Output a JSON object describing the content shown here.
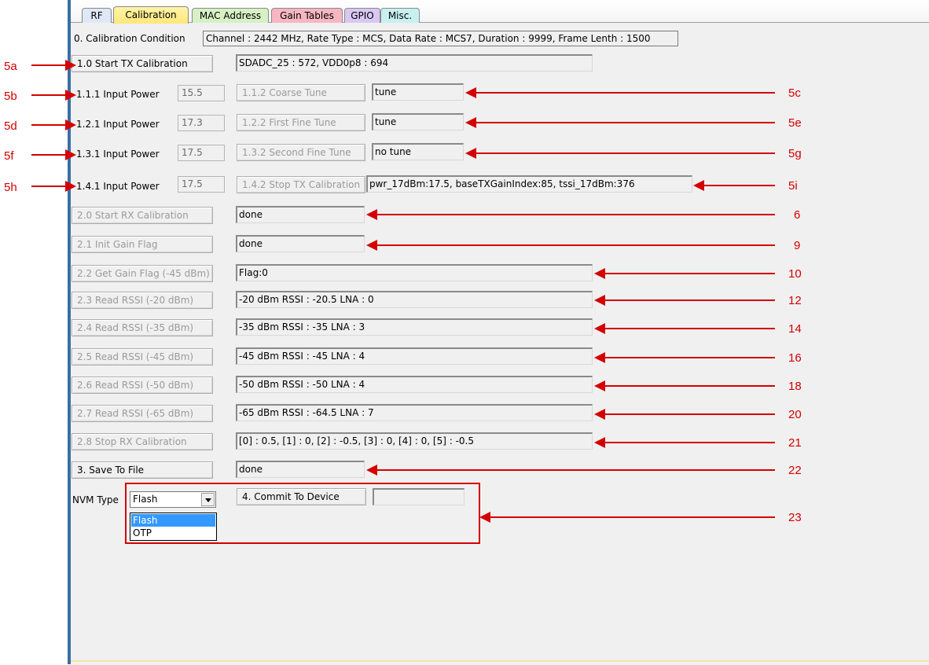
{
  "tabs": [
    {
      "label": "RF",
      "color": "#dfe8f7"
    },
    {
      "label": "Calibration",
      "color": "#ffe77a"
    },
    {
      "label": "MAC Address",
      "color": "#d7f0c4"
    },
    {
      "label": "Gain Tables",
      "color": "#f7b6c2"
    },
    {
      "label": "GPIO",
      "color": "#d9c8f2"
    },
    {
      "label": "Misc.",
      "color": "#c8f0f0"
    }
  ],
  "condition": {
    "label": "0. Calibration Condition",
    "value": "Channel : 2442 MHz, Rate Type : MCS, Data Rate : MCS7, Duration : 9999, Frame Lenth : 1500"
  },
  "tx": {
    "start_button": "1.0 Start TX Calibration",
    "start_result": "SDADC_25 : 572, VDD0p8 : 694",
    "rows": [
      {
        "label": "1.1.1 Input Power",
        "power": "15.5",
        "button": "1.1.2 Coarse Tune",
        "result": "tune"
      },
      {
        "label": "1.2.1 Input Power",
        "power": "17.3",
        "button": "1.2.2 First Fine Tune",
        "result": "tune"
      },
      {
        "label": "1.3.1 Input Power",
        "power": "17.5",
        "button": "1.3.2 Second Fine Tune",
        "result": "no tune"
      },
      {
        "label": "1.4.1 Input Power",
        "power": "17.5",
        "button": "1.4.2 Stop TX Calibration",
        "result": "pwr_17dBm:17.5, baseTXGainIndex:85, tssi_17dBm:376"
      }
    ]
  },
  "rx": {
    "rows": [
      {
        "button": "2.0 Start RX Calibration",
        "result": "done"
      },
      {
        "button": "2.1 Init Gain Flag",
        "result": "done"
      },
      {
        "button": "2.2 Get Gain Flag (-45 dBm)",
        "result": "Flag:0"
      },
      {
        "button": "2.3 Read RSSI (-20 dBm)",
        "result": "-20 dBm RSSI : -20.5 LNA : 0"
      },
      {
        "button": "2.4 Read RSSI (-35 dBm)",
        "result": "-35 dBm RSSI : -35 LNA : 3"
      },
      {
        "button": "2.5 Read RSSI (-45 dBm)",
        "result": "-45 dBm RSSI : -45 LNA : 4"
      },
      {
        "button": "2.6 Read RSSI (-50 dBm)",
        "result": "-50 dBm RSSI : -50 LNA : 4"
      },
      {
        "button": "2.7 Read RSSI (-65 dBm)",
        "result": "-65 dBm RSSI : -64.5 LNA : 7"
      },
      {
        "button": "2.8 Stop RX Calibration",
        "result": "[0] : 0.5, [1] : 0, [2] : -0.5, [3] : 0, [4] : 0, [5] : -0.5"
      }
    ]
  },
  "save": {
    "button": "3. Save To File",
    "result": "done"
  },
  "nvm": {
    "label": "NVM Type",
    "selected": "Flash",
    "options": [
      "Flash",
      "OTP"
    ],
    "commit_button": "4. Commit To Device",
    "commit_result": ""
  },
  "annotations": {
    "left": [
      "5a",
      "5b",
      "5d",
      "5f",
      "5h"
    ],
    "right": [
      "5c",
      "5e",
      "5g",
      "5i",
      "6",
      "9",
      "10",
      "12",
      "14",
      "16",
      "18",
      "20",
      "21",
      "22",
      "23"
    ]
  },
  "colors": {
    "annotation": "#d40000",
    "panel": "#f0f0f0",
    "accent_window": "#3b6ea5",
    "selection": "#3399ff"
  }
}
